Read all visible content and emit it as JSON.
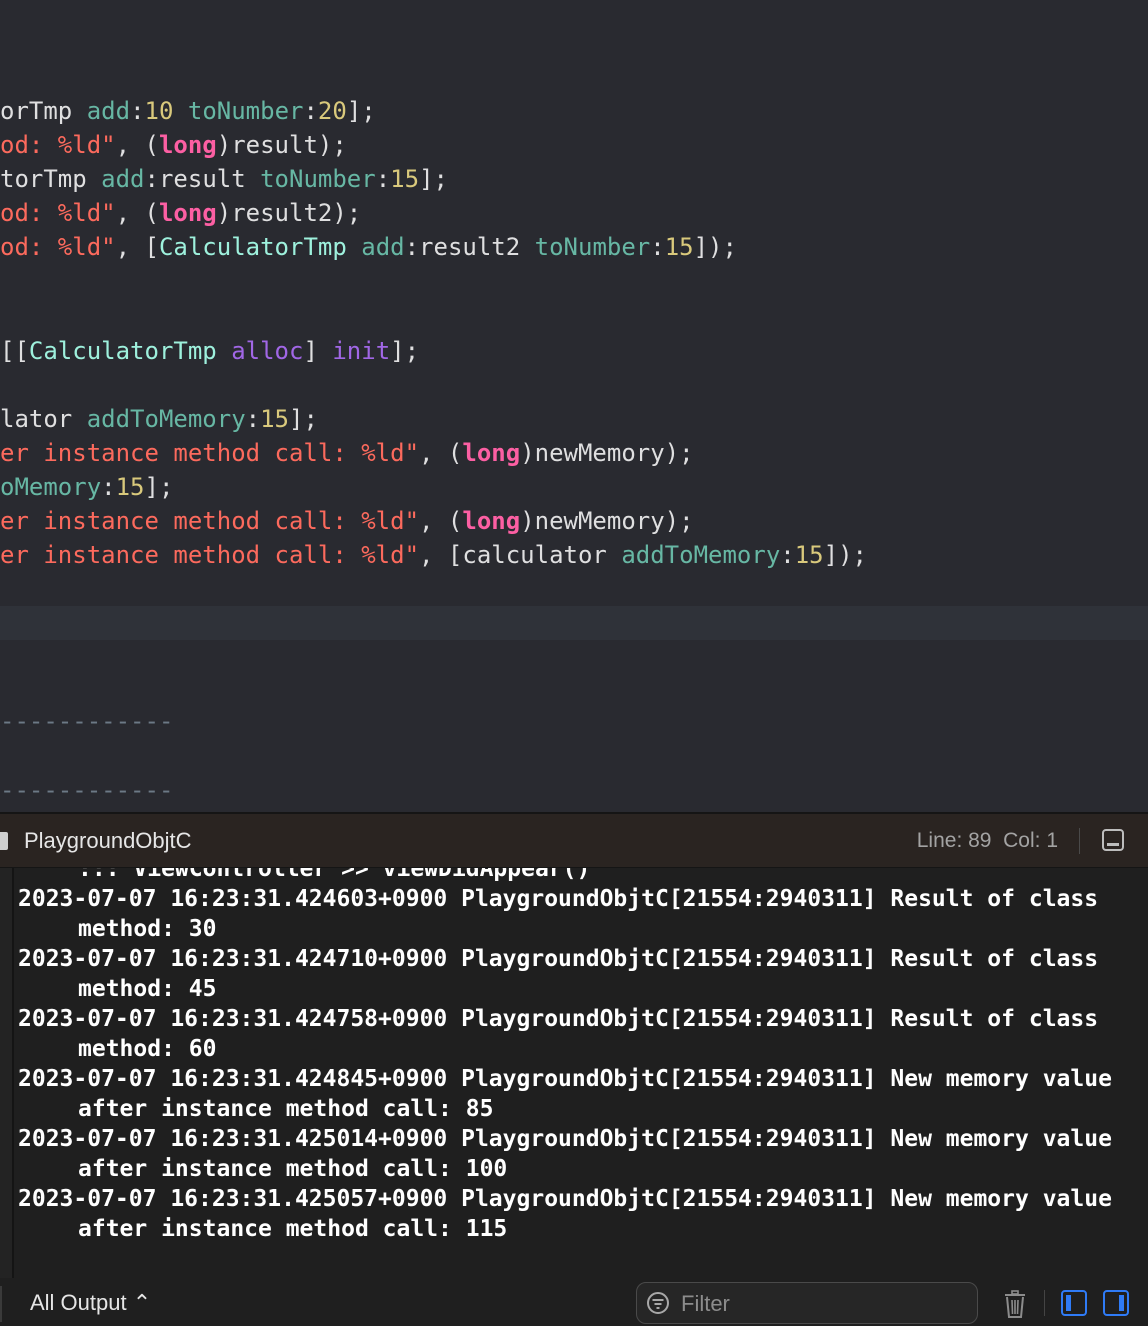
{
  "editor": {
    "lines": [
      [
        [
          "orTmp ",
          "plain"
        ],
        [
          "add",
          "method"
        ],
        [
          ":",
          "plain"
        ],
        [
          "10",
          "number"
        ],
        [
          " ",
          "plain"
        ],
        [
          "toNumber",
          "method"
        ],
        [
          ":",
          "plain"
        ],
        [
          "20",
          "number"
        ],
        [
          "];",
          "plain"
        ]
      ],
      [
        [
          "od: %ld\"",
          "string"
        ],
        [
          ", (",
          "plain"
        ],
        [
          "long",
          "keyword"
        ],
        [
          ")result);",
          "plain"
        ]
      ],
      [
        [
          "torTmp ",
          "plain"
        ],
        [
          "add",
          "method"
        ],
        [
          ":result ",
          "plain"
        ],
        [
          "toNumber",
          "method"
        ],
        [
          ":",
          "plain"
        ],
        [
          "15",
          "number"
        ],
        [
          "];",
          "plain"
        ]
      ],
      [
        [
          "od: %ld\"",
          "string"
        ],
        [
          ", (",
          "plain"
        ],
        [
          "long",
          "keyword"
        ],
        [
          ")result2);",
          "plain"
        ]
      ],
      [
        [
          "od: %ld\"",
          "string"
        ],
        [
          ", [",
          "plain"
        ],
        [
          "CalculatorTmp",
          "class"
        ],
        [
          " ",
          "plain"
        ],
        [
          "add",
          "method"
        ],
        [
          ":result2 ",
          "plain"
        ],
        [
          "toNumber",
          "method"
        ],
        [
          ":",
          "plain"
        ],
        [
          "15",
          "number"
        ],
        [
          "]);",
          "plain"
        ]
      ],
      [
        [
          "[[",
          "plain"
        ],
        [
          "CalculatorTmp",
          "class"
        ],
        [
          " ",
          "plain"
        ],
        [
          "alloc",
          "selector"
        ],
        [
          "] ",
          "plain"
        ],
        [
          "init",
          "selector"
        ],
        [
          "];",
          "plain"
        ]
      ],
      [
        [
          "lator ",
          "plain"
        ],
        [
          "addToMemory",
          "method"
        ],
        [
          ":",
          "plain"
        ],
        [
          "15",
          "number"
        ],
        [
          "];",
          "plain"
        ]
      ],
      [
        [
          "er instance method call: %ld\"",
          "string"
        ],
        [
          ", (",
          "plain"
        ],
        [
          "long",
          "keyword"
        ],
        [
          ")newMemory);",
          "plain"
        ]
      ],
      [
        [
          "oMemory",
          "method"
        ],
        [
          ":",
          "plain"
        ],
        [
          "15",
          "number"
        ],
        [
          "];",
          "plain"
        ]
      ],
      [
        [
          "er instance method call: %ld\"",
          "string"
        ],
        [
          ", (",
          "plain"
        ],
        [
          "long",
          "keyword"
        ],
        [
          ")newMemory);",
          "plain"
        ]
      ],
      [
        [
          "er instance method call: %ld\"",
          "string"
        ],
        [
          ", [calculator ",
          "plain"
        ],
        [
          "addToMemory",
          "method"
        ],
        [
          ":",
          "plain"
        ],
        [
          "15",
          "number"
        ],
        [
          "]);",
          "plain"
        ]
      ],
      [
        [
          "------------",
          "comment"
        ]
      ],
      [
        [
          "------------",
          "comment"
        ]
      ]
    ]
  },
  "debug_bar": {
    "scheme_name": "PlaygroundObjtC",
    "line_col": "Line: 89  Col: 1"
  },
  "console": {
    "partial_top": "::: ViewController >> viewDidAppear()",
    "entries": [
      "2023-07-07 16:23:31.424603+0900 PlaygroundObjtC[21554:2940311] Result of class method: 30",
      "2023-07-07 16:23:31.424710+0900 PlaygroundObjtC[21554:2940311] Result of class method: 45",
      "2023-07-07 16:23:31.424758+0900 PlaygroundObjtC[21554:2940311] Result of class method: 60",
      "2023-07-07 16:23:31.424845+0900 PlaygroundObjtC[21554:2940311] New memory value after instance method call: 85",
      "2023-07-07 16:23:31.425014+0900 PlaygroundObjtC[21554:2940311] New memory value after instance method call: 100",
      "2023-07-07 16:23:31.425057+0900 PlaygroundObjtC[21554:2940311] New memory value after instance method call: 115"
    ]
  },
  "filter_bar": {
    "output_label": "All Output ⌃",
    "filter_placeholder": "Filter"
  },
  "icons": {
    "scheme": "scheme-icon",
    "panel_toggle": "bottom-panel-icon",
    "filter": "filter-icon",
    "trash": "trash-icon",
    "split_left": "sidebar-left-icon",
    "split_right": "sidebar-right-icon"
  },
  "colors": {
    "editor_bg": "#292a30",
    "console_bg": "#1f1f1f",
    "accent": "#2f7bf6"
  }
}
